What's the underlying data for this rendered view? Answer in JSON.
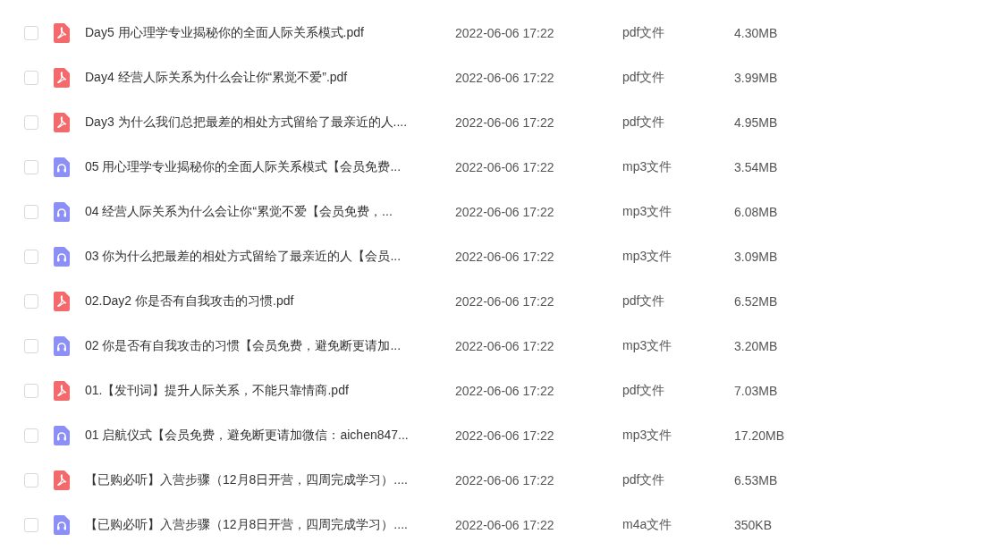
{
  "files": [
    {
      "kind": "pdf",
      "checked": false,
      "name": "Day5 用心理学专业揭秘你的全面人际关系模式.pdf",
      "modified": "2022-06-06 17:22",
      "type": "pdf文件",
      "size": "4.30MB"
    },
    {
      "kind": "pdf",
      "checked": false,
      "name": "Day4 经营人际关系为什么会让你“累觉不爱”.pdf",
      "modified": "2022-06-06 17:22",
      "type": "pdf文件",
      "size": "3.99MB"
    },
    {
      "kind": "pdf",
      "checked": false,
      "name": "Day3 为什么我们总把最差的相处方式留给了最亲近的人....",
      "modified": "2022-06-06 17:22",
      "type": "pdf文件",
      "size": "4.95MB"
    },
    {
      "kind": "audio",
      "checked": false,
      "name": "05 用心理学专业揭秘你的全面人际关系模式【会员免费...",
      "modified": "2022-06-06 17:22",
      "type": "mp3文件",
      "size": "3.54MB"
    },
    {
      "kind": "audio",
      "checked": false,
      "name": "04 经营人际关系为什么会让你“累觉不爱【会员免费，...",
      "modified": "2022-06-06 17:22",
      "type": "mp3文件",
      "size": "6.08MB"
    },
    {
      "kind": "audio",
      "checked": false,
      "name": "03 你为什么把最差的相处方式留给了最亲近的人【会员...",
      "modified": "2022-06-06 17:22",
      "type": "mp3文件",
      "size": "3.09MB"
    },
    {
      "kind": "pdf",
      "checked": false,
      "name": "02.Day2 你是否有自我攻击的习惯.pdf",
      "modified": "2022-06-06 17:22",
      "type": "pdf文件",
      "size": "6.52MB"
    },
    {
      "kind": "audio",
      "checked": false,
      "name": "02 你是否有自我攻击的习惯【会员免费，避免断更请加...",
      "modified": "2022-06-06 17:22",
      "type": "mp3文件",
      "size": "3.20MB"
    },
    {
      "kind": "pdf",
      "checked": false,
      "name": "01.【发刊词】提升人际关系，不能只靠情商.pdf",
      "modified": "2022-06-06 17:22",
      "type": "pdf文件",
      "size": "7.03MB"
    },
    {
      "kind": "audio",
      "checked": false,
      "name": "01 启航仪式【会员免费，避免断更请加微信：aichen847...",
      "modified": "2022-06-06 17:22",
      "type": "mp3文件",
      "size": "17.20MB"
    },
    {
      "kind": "pdf",
      "checked": false,
      "name": "【已购必听】入营步骤（12月8日开营，四周完成学习）....",
      "modified": "2022-06-06 17:22",
      "type": "pdf文件",
      "size": "6.53MB"
    },
    {
      "kind": "audio",
      "checked": false,
      "name": "【已购必听】入营步骤（12月8日开营，四周完成学习）....",
      "modified": "2022-06-06 17:22",
      "type": "m4a文件",
      "size": "350KB"
    }
  ]
}
